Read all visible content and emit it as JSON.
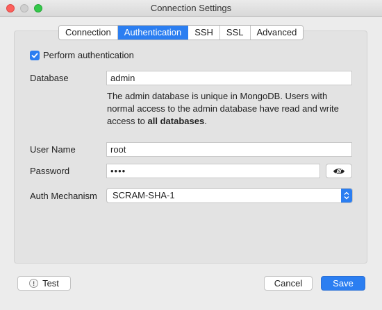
{
  "window": {
    "title": "Connection Settings"
  },
  "tabs": [
    {
      "label": "Connection",
      "active": false
    },
    {
      "label": "Authentication",
      "active": true
    },
    {
      "label": "SSH",
      "active": false
    },
    {
      "label": "SSL",
      "active": false
    },
    {
      "label": "Advanced",
      "active": false
    }
  ],
  "auth": {
    "perform_label": "Perform authentication",
    "perform_checked": true,
    "database_label": "Database",
    "database_value": "admin",
    "help_text_1": "The admin database is unique in MongoDB. Users with normal access to the admin database have read and write access to ",
    "help_text_bold": "all databases",
    "help_text_2": ".",
    "username_label": "User Name",
    "username_value": "root",
    "password_label": "Password",
    "password_value": "••••",
    "password_toggle_icon": "eye-icon",
    "mechanism_label": "Auth Mechanism",
    "mechanism_value": "SCRAM-SHA-1"
  },
  "footer": {
    "test_label": "Test",
    "test_icon": "exclamation-icon",
    "cancel_label": "Cancel",
    "save_label": "Save"
  },
  "colors": {
    "accent": "#2b7ef1"
  }
}
